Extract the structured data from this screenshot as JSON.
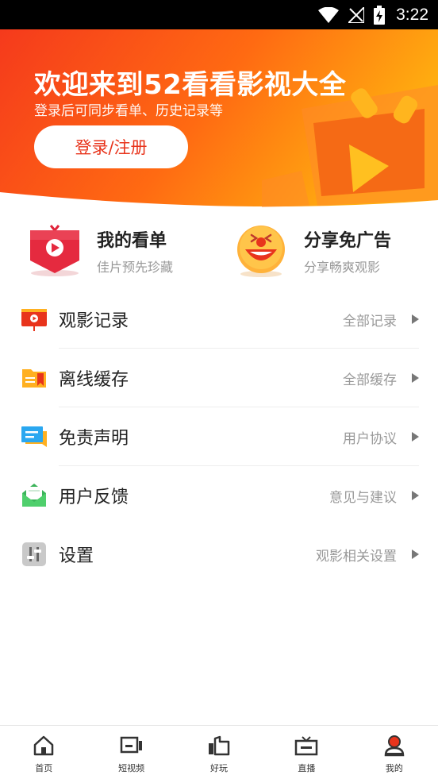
{
  "status_bar": {
    "time": "3:22"
  },
  "banner": {
    "title": "欢迎来到52看看影视大全",
    "subtitle": "登录后可同步看单、历史记录等",
    "login_label": "登录/注册"
  },
  "quick_cards": [
    {
      "title": "我的看单",
      "subtitle": "佳片预先珍藏"
    },
    {
      "title": "分享免广告",
      "subtitle": "分享畅爽观影"
    }
  ],
  "menu": [
    {
      "label": "观影记录",
      "right": "全部记录",
      "icon": "history-icon"
    },
    {
      "label": "离线缓存",
      "right": "全部缓存",
      "icon": "folder-icon"
    },
    {
      "label": "免责声明",
      "right": "用户协议",
      "icon": "message-icon"
    },
    {
      "label": "用户反馈",
      "right": "意见与建议",
      "icon": "mail-icon"
    },
    {
      "label": "设置",
      "right": "观影相关设置",
      "icon": "settings-icon"
    }
  ],
  "tabs": [
    {
      "label": "首页",
      "icon": "home-icon"
    },
    {
      "label": "短视频",
      "icon": "short-video-icon"
    },
    {
      "label": "好玩",
      "icon": "fun-icon"
    },
    {
      "label": "直播",
      "icon": "tv-icon"
    },
    {
      "label": "我的",
      "icon": "profile-icon",
      "active": true
    }
  ],
  "colors": {
    "accent": "#e8341c",
    "banner_start": "#f53a1c",
    "banner_end": "#ffae10",
    "muted_text": "#999999"
  }
}
